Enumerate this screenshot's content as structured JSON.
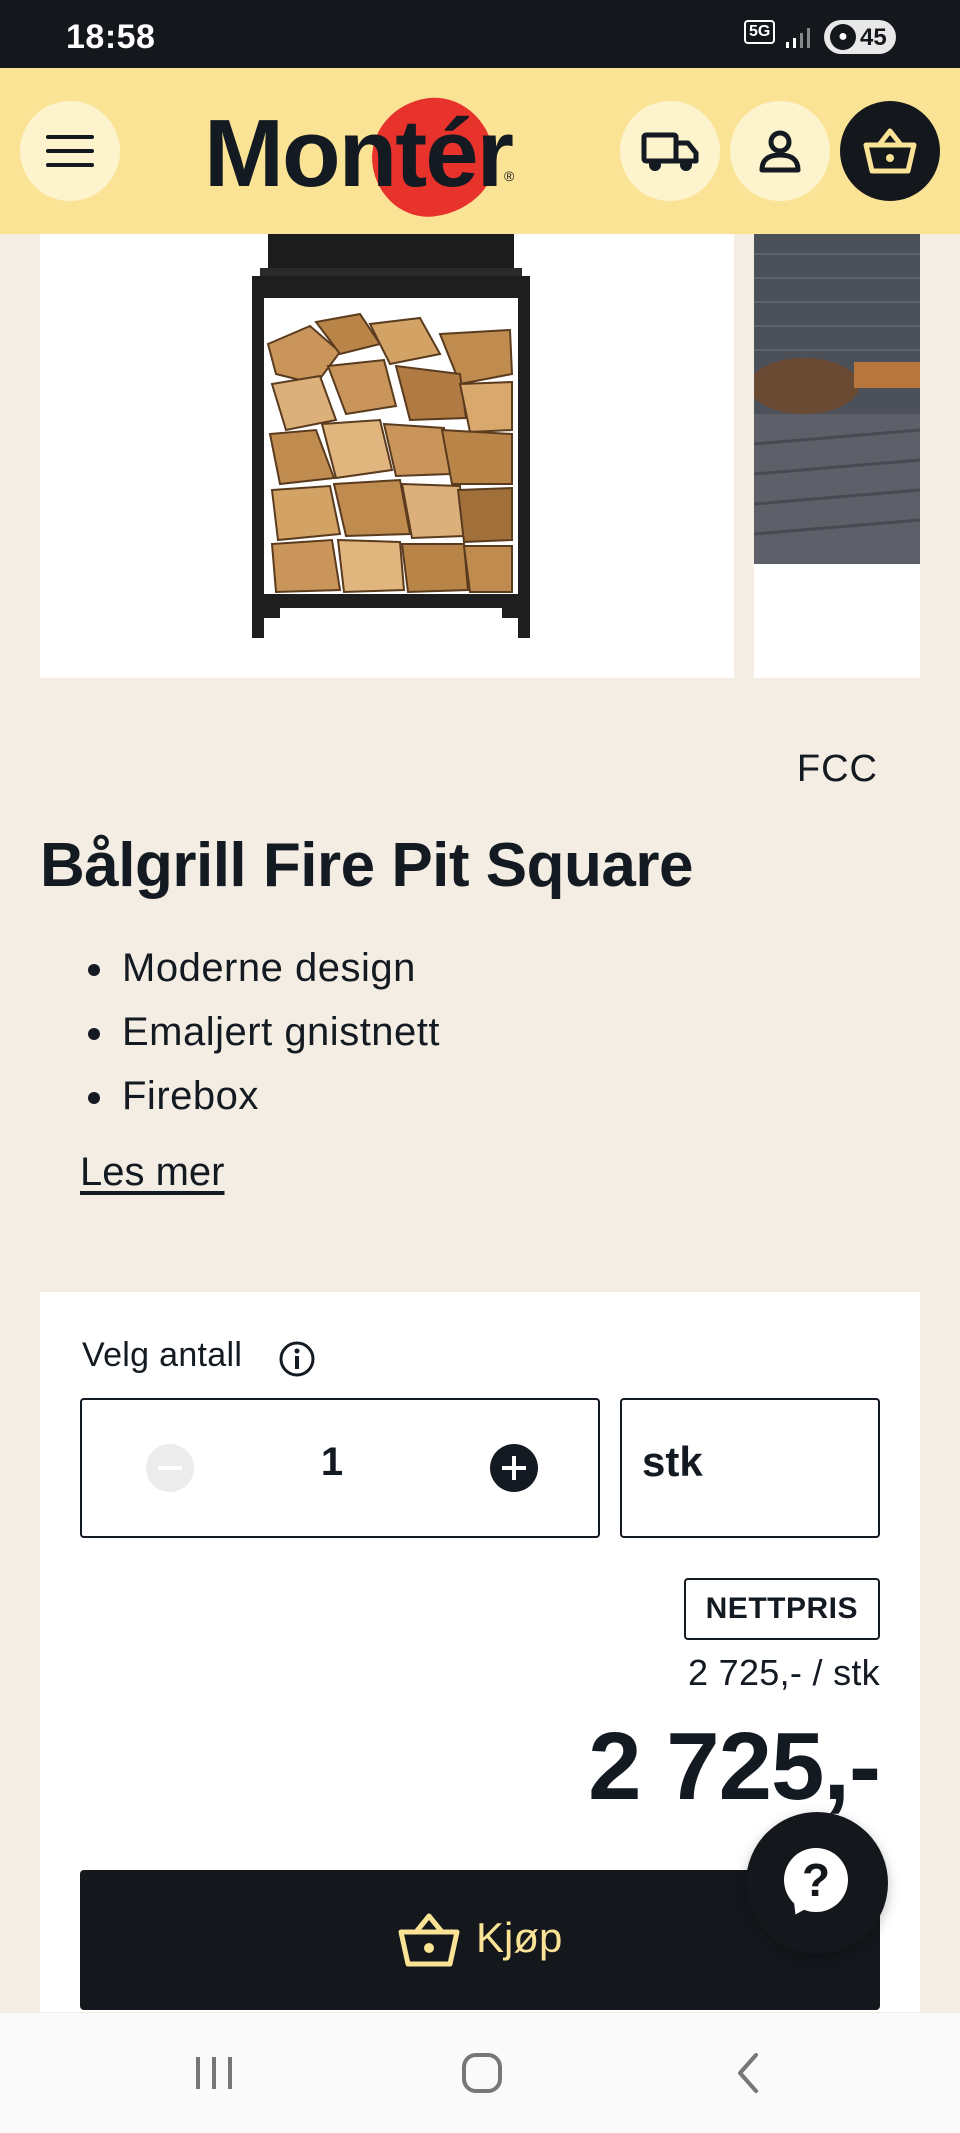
{
  "status_bar": {
    "time": "18:58",
    "network": "5G",
    "battery": "45"
  },
  "header": {
    "logo_text": "Montér",
    "logo_registered": "®",
    "colors": {
      "header_bg": "#fbe395",
      "logo_blob": "#e8322c",
      "dark": "#14171c"
    },
    "icons": [
      "menu-icon",
      "delivery-truck-icon",
      "user-icon",
      "shopping-basket-icon"
    ]
  },
  "product": {
    "brand": "FCC",
    "title": "Bålgrill Fire Pit Square",
    "features": [
      "Moderne design",
      "Emaljert gnistnett",
      "Firebox"
    ],
    "read_more": "Les mer"
  },
  "purchase": {
    "quantity_label": "Velg antall",
    "quantity": "1",
    "unit": "stk",
    "price_badge": "NETTPRIS",
    "unit_price": "2 725,- / stk",
    "total_price": "2 725,-",
    "buy_label": "Kjøp"
  },
  "help": {
    "icon": "?"
  }
}
